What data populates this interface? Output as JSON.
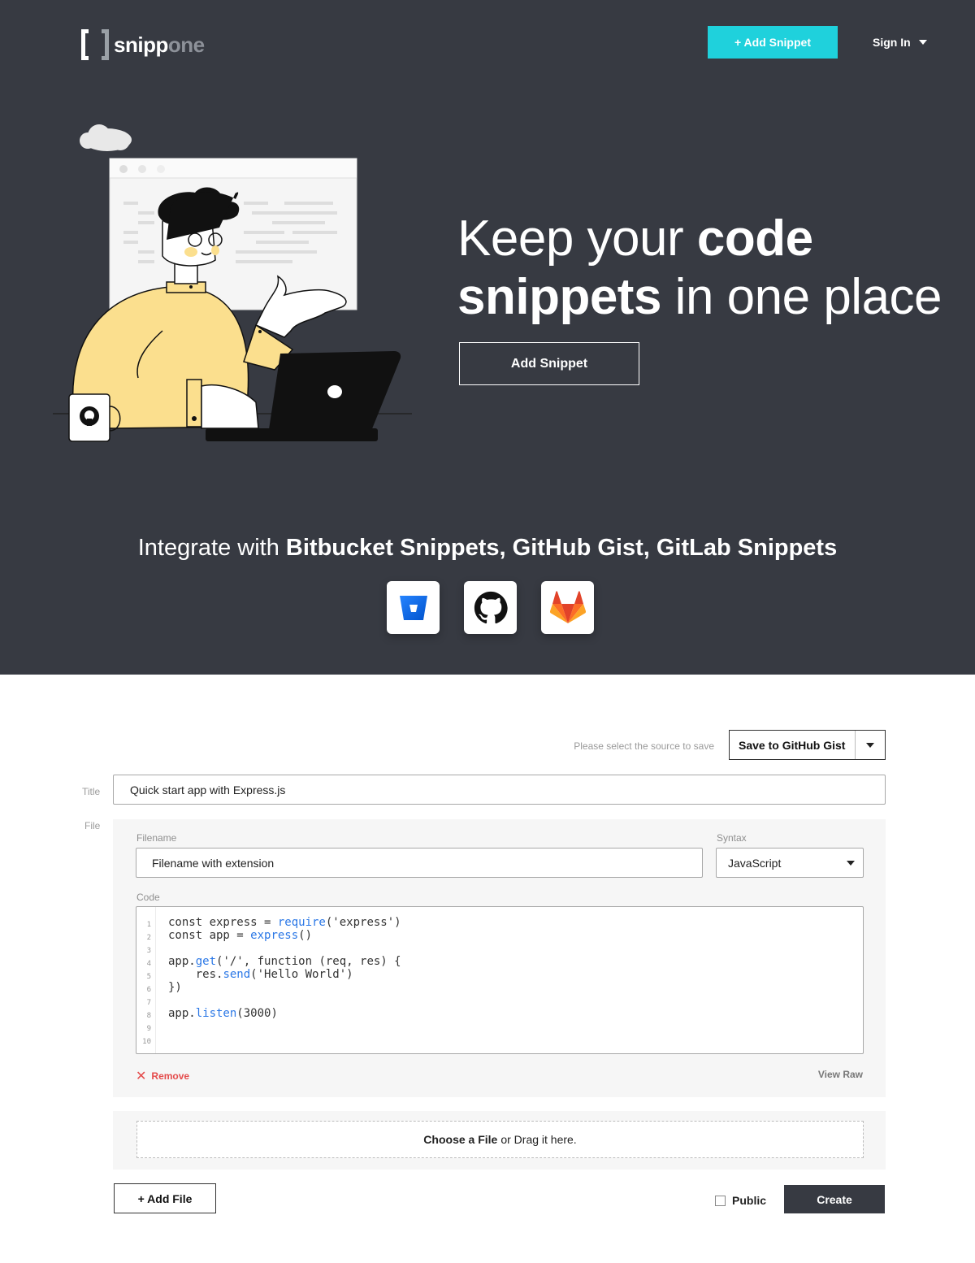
{
  "header": {
    "logo_main": "snipp",
    "logo_accent": "one",
    "add_snippet_label": "+ Add Snippet",
    "sign_in_label": "Sign In"
  },
  "hero": {
    "headline_pre": "Keep your ",
    "headline_bold1": "code",
    "headline_bold2": "snippets",
    "headline_post": " in one place",
    "cta_label": "Add Snippet",
    "integrate_pre": "Integrate with ",
    "integrate_bold": "Bitbucket Snippets, GitHub Gist, GitLab Snippets",
    "integrations": [
      "bitbucket-icon",
      "github-icon",
      "gitlab-icon"
    ]
  },
  "form": {
    "source_prompt": "Please select the source to save",
    "source_selected": "Save to GitHub Gist",
    "title_label": "Title",
    "title_value": "Quick start app with Express.js",
    "file_label": "File",
    "filename_label": "Filename",
    "filename_placeholder": "Filename with extension",
    "syntax_label": "Syntax",
    "syntax_selected": "JavaScript",
    "code_label": "Code",
    "code_line_numbers": [
      "1",
      "2",
      "3",
      "4",
      "5",
      "6",
      "7",
      "8",
      "9",
      "10"
    ],
    "remove_label": "Remove",
    "view_raw_label": "View Raw",
    "drop_bold": "Choose a File",
    "drop_rest": "or Drag it here.",
    "add_file_label": "+ Add File",
    "public_label": "Public",
    "create_label": "Create"
  },
  "colors": {
    "hero_bg": "#373a42",
    "accent": "#1fd1dc",
    "code_keyword": "#2a77e6",
    "remove": "#e44b4b"
  }
}
